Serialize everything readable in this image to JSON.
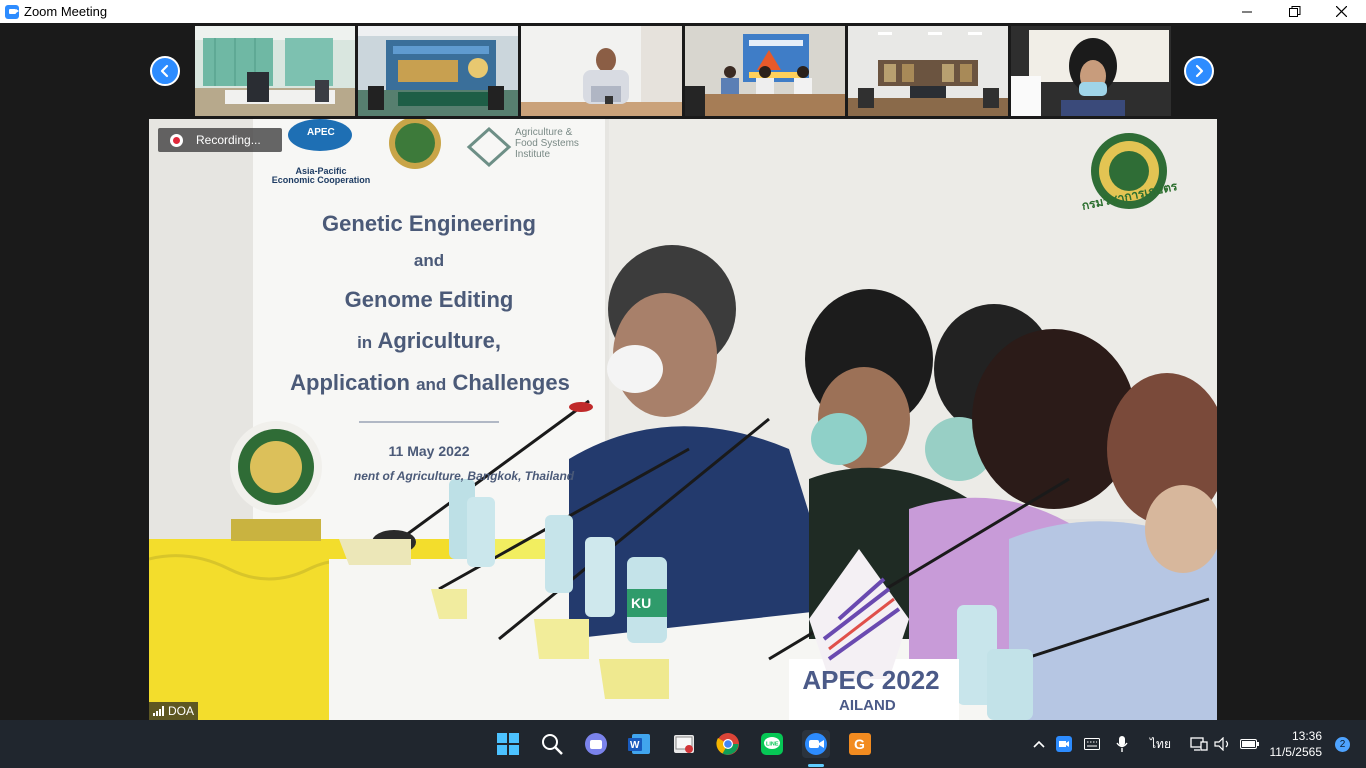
{
  "window": {
    "title": "Zoom Meeting"
  },
  "recording": {
    "label": "Recording..."
  },
  "main_video": {
    "name_label": "DOA",
    "poster": {
      "logo1_text": "APEC",
      "logo1_sub": "Asia-Pacific\nEconomic Cooperation",
      "logo3_text": "Agriculture &\nFood Systems\nInstitute",
      "line1": "Genetic Engineering",
      "line2": "and",
      "line3": "Genome Editing",
      "line4_small": "in",
      "line4_big": "Agriculture,",
      "line5_big1": "Application",
      "line5_small": "and",
      "line5_big2": "Challenges",
      "date": "11 May 2022",
      "venue": "nent of Agriculture, Bangkok, Thailand"
    },
    "seal_caption": "กรมวิชาการเกษตร",
    "nameplate": "APEC 2022",
    "nameplate_sub": "AILAND",
    "bottle_label": "KU"
  },
  "thumbnails": [
    {
      "id": "thumb-1",
      "scene": "empty meeting room"
    },
    {
      "id": "thumb-2",
      "scene": "conference room with banner"
    },
    {
      "id": "thumb-3",
      "scene": "man at desk"
    },
    {
      "id": "thumb-4",
      "scene": "meeting with banner"
    },
    {
      "id": "thumb-5",
      "scene": "large conference room"
    },
    {
      "id": "thumb-6",
      "scene": "woman with mask"
    }
  ],
  "taskbar": {
    "language": "ไทย",
    "time": "13:36",
    "date": "11/5/2565",
    "notifications": "2"
  },
  "colors": {
    "zoom_blue": "#2d8cff",
    "taskbar": "#20262e"
  }
}
